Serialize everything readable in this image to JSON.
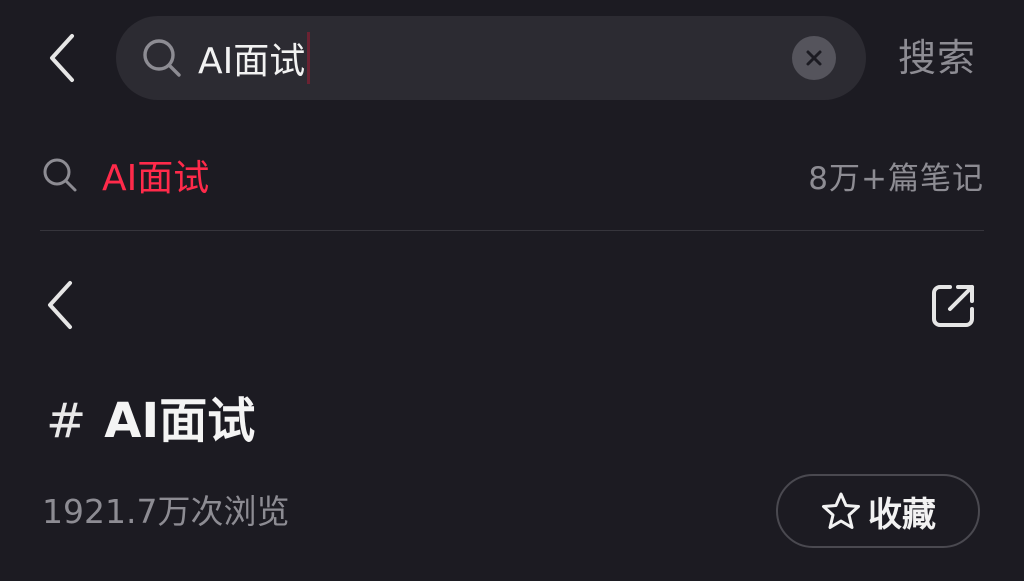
{
  "header": {
    "back_icon": "chevron-left-icon",
    "search": {
      "value": "AI面试",
      "placeholder": "",
      "search_icon": "search-icon",
      "clear_icon": "close-icon"
    },
    "search_button_label": "搜索"
  },
  "suggestion": {
    "icon": "search-icon",
    "text": "AI面试",
    "count": "8万+篇笔记",
    "highlight_color": "#ff2a4a"
  },
  "topic": {
    "back_icon": "chevron-left-icon",
    "share_icon": "share-icon",
    "hash": "#",
    "title": "AI面试",
    "views": "1921.7万次浏览",
    "favorite": {
      "icon": "star-icon",
      "label": "收藏"
    }
  },
  "colors": {
    "background": "#1c1b22",
    "search_box": "#2c2b32",
    "muted_text": "#8d8c93",
    "accent": "#ff2a4a"
  }
}
